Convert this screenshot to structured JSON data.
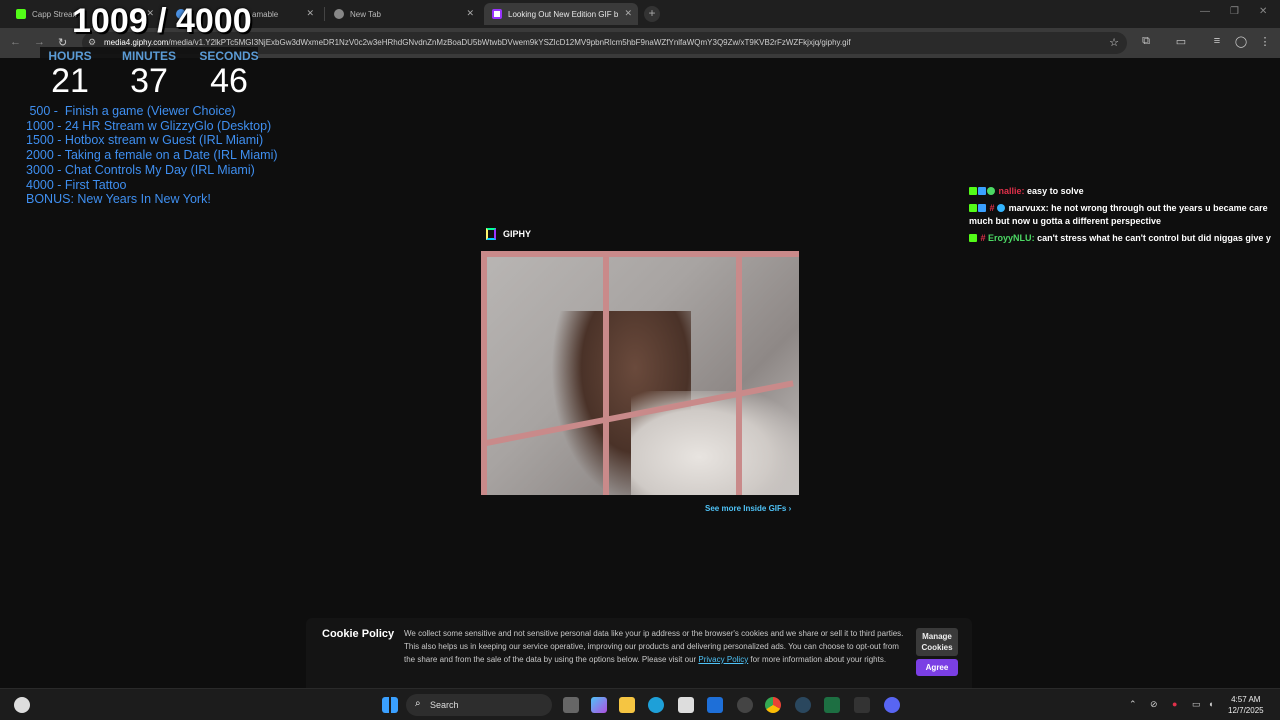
{
  "browser": {
    "tabs": [
      {
        "title": "Capp Stream",
        "active": false
      },
      {
        "title": "amable",
        "active": false
      },
      {
        "title": "New Tab",
        "active": false
      },
      {
        "title": "Looking Out New Edition GIF b",
        "active": true
      }
    ],
    "url_host": "media4.giphy.com",
    "url_path": "/media/v1.Y2lkPTc5MGI3NjExbGw3dWxmeDR1NzV0c2w3eHRhdGNvdnZnMzBoaDU5bWtwbDVwem9kYSZlcD12MV9pbnRlcm5hbF9naWZfYnlfaWQmY3Q9Zw/xT9KVB2rFzWZFkjxjq/giphy.gif"
  },
  "overlay": {
    "counter": "1009 / 4000",
    "timer": {
      "hours_label": "HOURS",
      "hours": "21",
      "minutes_label": "MINUTES",
      "minutes": "37",
      "seconds_label": "SECONDS",
      "seconds": "46"
    },
    "goals": [
      " 500 -  Finish a game (Viewer Choice)",
      "1000 - 24 HR Stream w GlizzyGlo (Desktop)",
      "1500 - Hotbox stream w Guest (IRL Miami)",
      "2000 - Taking a female on a Date (IRL Miami)",
      "3000 - Chat Controls My Day (IRL Miami)",
      "4000 - First Tattoo",
      "BONUS: New Years In New York!"
    ]
  },
  "chat": [
    {
      "user": "nallie",
      "user_color": "#e0304a",
      "text": "easy to solve"
    },
    {
      "user": "marvuxx",
      "user_color": "#ffffff",
      "text": "he not wrong through out the years u became care much but now u gotta a different perspective"
    },
    {
      "user": "EroyyNLU",
      "user_color": "#4cd964",
      "text": "can't stress what he can't control but did niggas give y"
    }
  ],
  "giphy": {
    "brand": "GIPHY",
    "see_more": "See more Inside GIFs"
  },
  "cookie": {
    "title": "Cookie Policy",
    "text_before": "We collect some sensitive and not sensitive personal data like your ip address or the browser's cookies and we share or sell it to third parties. This also helps us in keeping our service operative, improving our products and delivering personalized ads. You can choose to opt-out from the share and from the sale of the data by using the options below. Please visit our ",
    "link": "Privacy Policy",
    "text_after": " for more information about your rights.",
    "manage_label_1": "Manage",
    "manage_label_2": "Cookies",
    "agree_label": "Agree"
  },
  "taskbar": {
    "search_label": "Search",
    "time": "4:57 AM",
    "date": "12/7/2025"
  },
  "colors": {
    "goal_blue": "#3f8ff0",
    "timer_label": "#5b9bd5",
    "agree_purple": "#7b3fe4",
    "link_cyan": "#4fc3f7"
  }
}
